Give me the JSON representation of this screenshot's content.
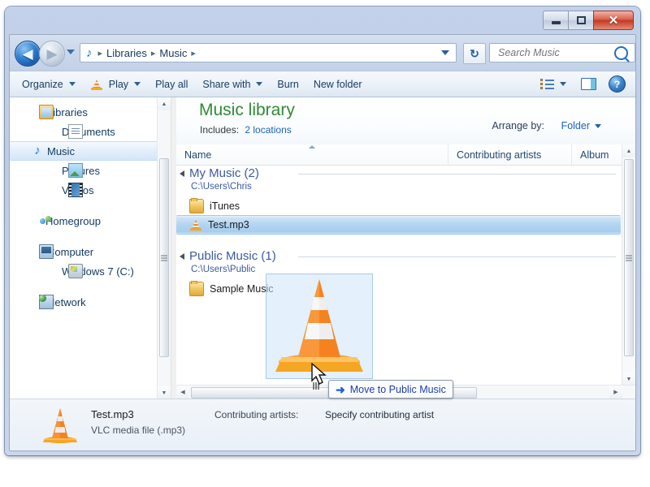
{
  "window": {
    "controls": {
      "minimize": "Minimize",
      "maximize": "Maximize",
      "close": "✕"
    }
  },
  "address_bar": {
    "back_label": "◀",
    "forward_label": "▶",
    "music_note_icon": "♪",
    "crumbs": [
      "Libraries",
      "Music"
    ],
    "separator": "▸",
    "refresh_label": "↻"
  },
  "search": {
    "placeholder": "Search Music",
    "value": ""
  },
  "toolbar": {
    "organize": "Organize",
    "play": "Play",
    "play_all": "Play all",
    "share_with": "Share with",
    "burn": "Burn",
    "new_folder": "New folder",
    "help": "?"
  },
  "sidebar": {
    "items": [
      {
        "label": "Libraries",
        "icon": "libraries-icon",
        "level": 0,
        "selected": false
      },
      {
        "label": "Documents",
        "icon": "document-icon",
        "level": 1,
        "selected": false
      },
      {
        "label": "Music",
        "icon": "music-note-icon",
        "level": 1,
        "selected": true
      },
      {
        "label": "Pictures",
        "icon": "picture-icon",
        "level": 1,
        "selected": false
      },
      {
        "label": "Videos",
        "icon": "video-icon",
        "level": 1,
        "selected": false
      },
      {
        "label": "Homegroup",
        "icon": "homegroup-icon",
        "level": 0,
        "selected": false
      },
      {
        "label": "Computer",
        "icon": "computer-icon",
        "level": 0,
        "selected": false
      },
      {
        "label": "Windows 7 (C:)",
        "icon": "drive-icon",
        "level": 1,
        "selected": false
      },
      {
        "label": "Network",
        "icon": "network-icon",
        "level": 0,
        "selected": false
      }
    ]
  },
  "library": {
    "title": "Music library",
    "includes_label": "Includes:",
    "includes_value": "2 locations",
    "arrange_by_label": "Arrange by:",
    "arrange_by_value": "Folder"
  },
  "columns": {
    "name": "Name",
    "contributing_artists": "Contributing artists",
    "album": "Album"
  },
  "file_list": {
    "groups": [
      {
        "title": "My Music (2)",
        "path": "C:\\Users\\Chris",
        "rows": [
          {
            "name": "iTunes",
            "icon": "folder-icon",
            "selected": false
          },
          {
            "name": "Test.mp3",
            "icon": "vlc-cone-icon",
            "selected": true
          }
        ]
      },
      {
        "title": "Public Music (1)",
        "path": "C:\\Users\\Public",
        "rows": [
          {
            "name": "Sample Music",
            "icon": "folder-icon",
            "selected": false
          }
        ]
      }
    ]
  },
  "drag": {
    "tooltip_arrow": "➜",
    "tooltip_text": "Move to Public Music"
  },
  "details": {
    "name": "Test.mp3",
    "type": "VLC media file (.mp3)",
    "artists_label": "Contributing artists:",
    "artists_value": "Specify contributing artist"
  },
  "colors": {
    "library_title_green": "#2e8b35",
    "link_blue": "#1c62b3",
    "group_blue": "#3b5ba0",
    "selection_blue": "#b2d4f1",
    "vlc_orange": "#f08c1b",
    "close_red": "#c23a24"
  }
}
